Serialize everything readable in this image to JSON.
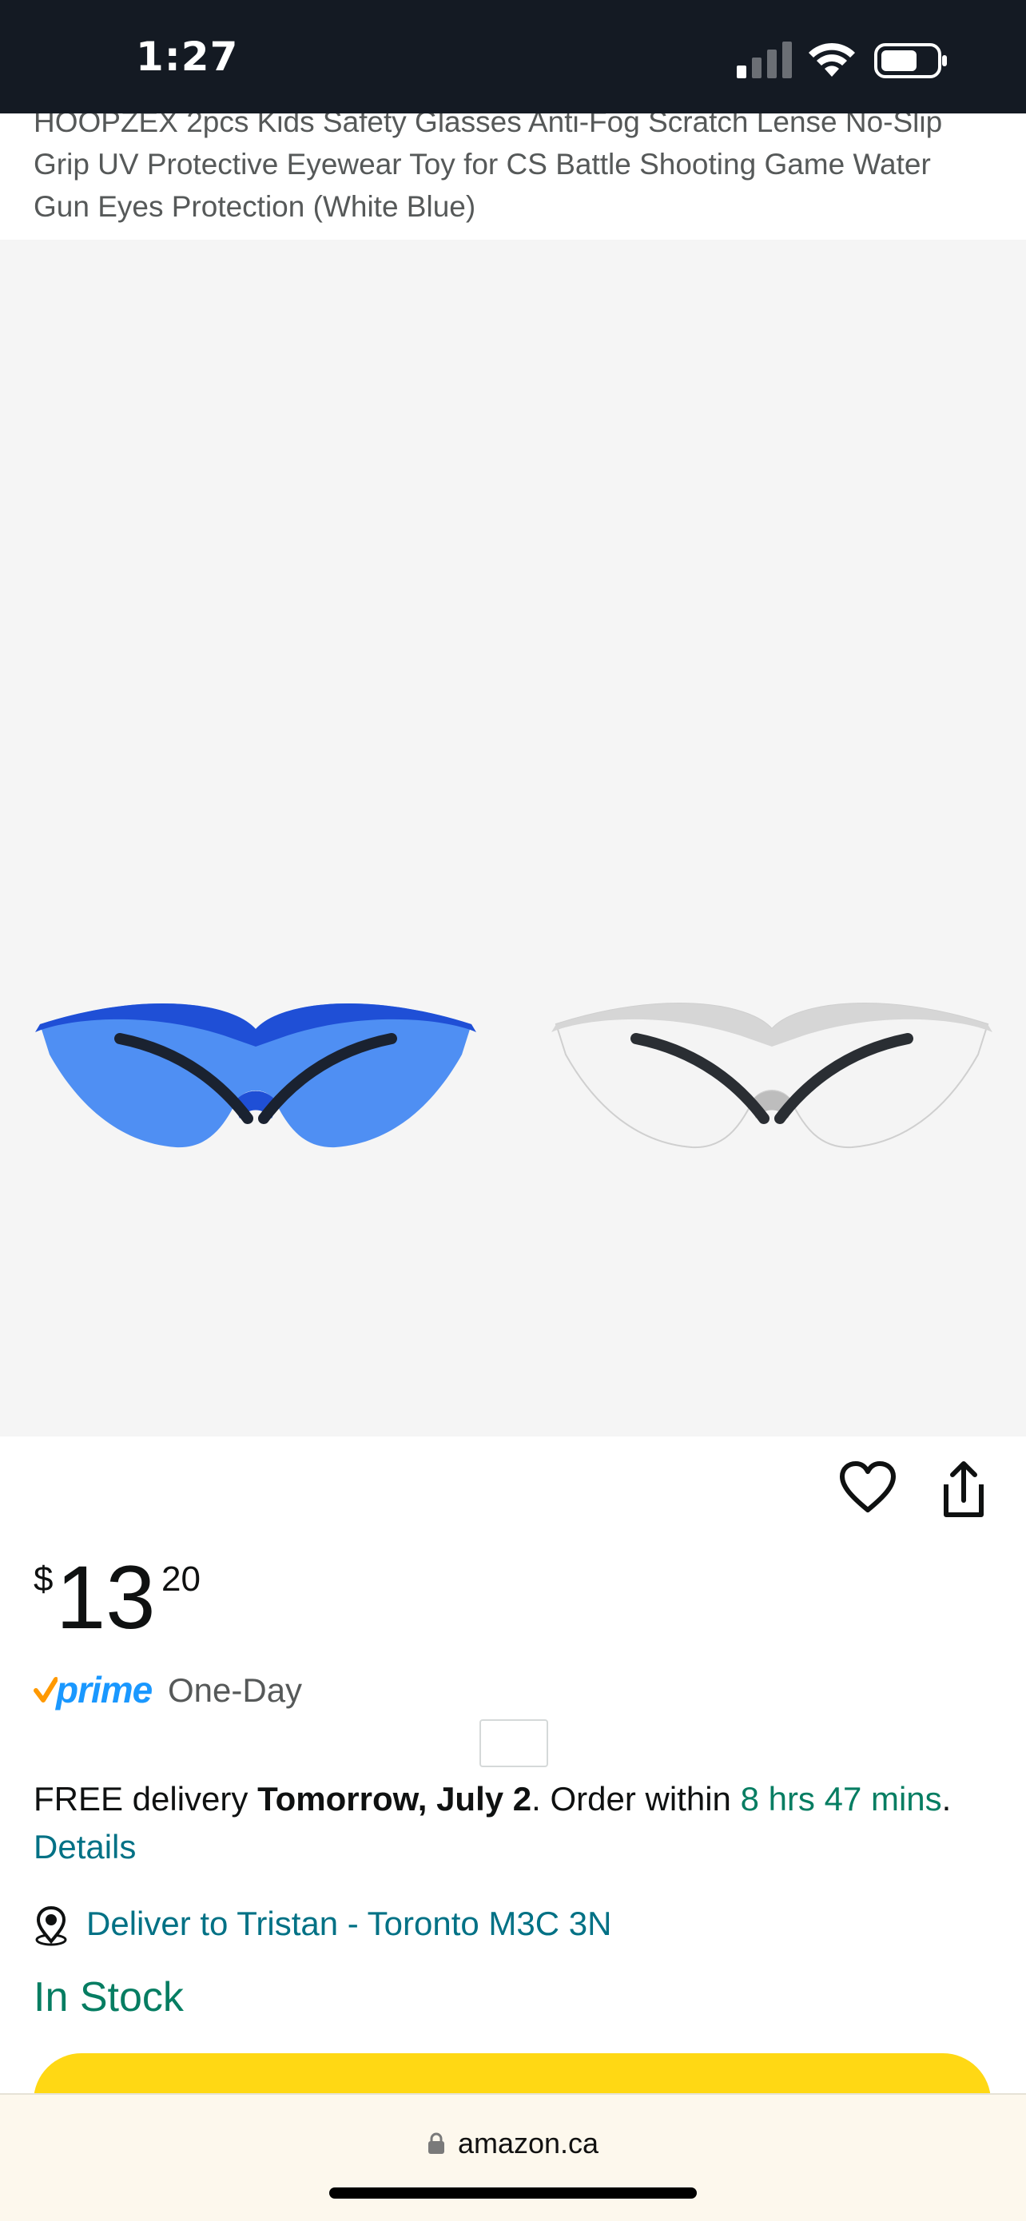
{
  "status_bar": {
    "time": "1:27"
  },
  "product": {
    "title_lines": [
      "HOOPZEX 2pcs Kids Safety Glasses Anti-Fog Scratch Lense No-Slip",
      "Grip UV Protective Eyewear Toy for CS Battle Shooting Game Water",
      "Gun Eyes Protection (White Blue)"
    ],
    "images": [
      {
        "icon": "blue-safety-glasses",
        "color": "#3b7bf0"
      },
      {
        "icon": "clear-safety-glasses",
        "color": "#e9e9e9"
      }
    ]
  },
  "price": {
    "symbol": "$",
    "whole": "13",
    "fraction": "20"
  },
  "prime": {
    "logo_text": "prime",
    "label": "One-Day"
  },
  "delivery": {
    "prefix": "FREE delivery ",
    "date": "Tomorrow, July 2",
    "middle": ". Order within ",
    "countdown": "8 hrs 47 mins",
    "period": ". ",
    "details_link": "Details"
  },
  "deliver_to": {
    "text": "Deliver to Tristan - Toronto M3C 3N"
  },
  "availability": "In Stock",
  "browser": {
    "url": "amazon.ca"
  },
  "colors": {
    "status_bar_bg": "#141a23",
    "image_bg": "#f5f5f5",
    "green": "#067d62",
    "link": "#007185",
    "prime_blue": "#1a98ff",
    "prime_check": "#ff9900",
    "cart_yellow": "#ffd814"
  }
}
